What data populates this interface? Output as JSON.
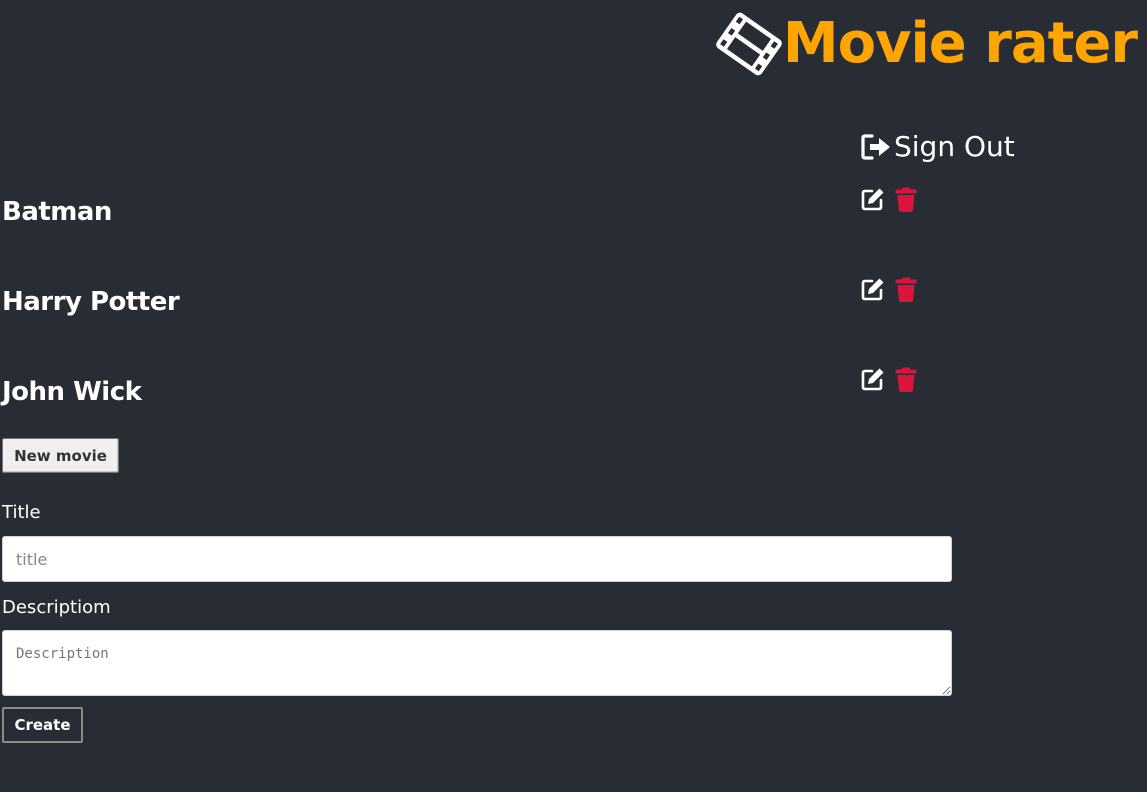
{
  "header": {
    "brand_icon": "film-icon",
    "title": "Movie rater",
    "accent_color": "#ffa500"
  },
  "auth": {
    "signout_icon": "sign-out-icon",
    "signout_label": "Sign Out"
  },
  "movies": [
    {
      "title": "Batman",
      "edit_icon": "edit-icon",
      "delete_icon": "trash-icon"
    },
    {
      "title": "Harry Potter",
      "edit_icon": "edit-icon",
      "delete_icon": "trash-icon"
    },
    {
      "title": "John Wick",
      "edit_icon": "edit-icon",
      "delete_icon": "trash-icon"
    }
  ],
  "colors": {
    "background": "#282c34",
    "delete": "#dc143c",
    "text": "#ffffff"
  },
  "form": {
    "new_movie_label": "New movie",
    "title_label": "Title",
    "title_placeholder": "title",
    "title_value": "",
    "description_label": "Descriptiom",
    "description_placeholder": "Description",
    "description_value": "",
    "create_label": "Create"
  }
}
